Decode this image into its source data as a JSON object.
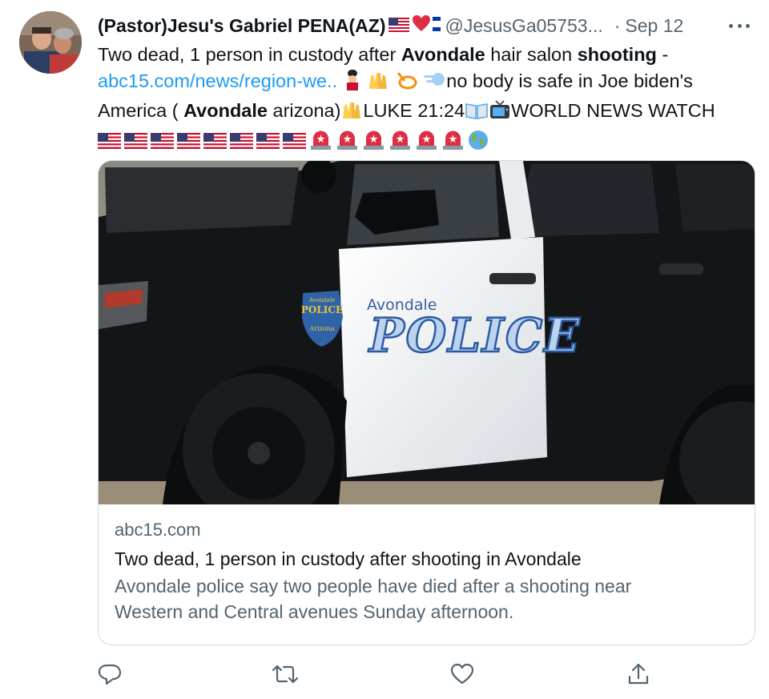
{
  "tweet": {
    "display_name": "(Pastor)Jesu's Gabriel PENA(AZ)",
    "handle": "@JesusGa05753...",
    "separator": "·",
    "date": "Sep 12",
    "text": {
      "part1": "Two dead, 1 person in custody after ",
      "bold1": "Avondale",
      "part2": " hair salon ",
      "bold2": "shooting",
      "part3": " -",
      "link": "abc15.com/news/region-we..",
      "part4": "no body is safe in Joe biden's",
      "part5": "America ( ",
      "bold3": "Avondale",
      "part6": " arizona)",
      "part7": "LUKE 21:24",
      "part8": "WORLD NEWS WATCH"
    },
    "emoji": [
      "guard-emoji",
      "raised-hands-emoji",
      "lasso-emoji",
      "dash-emoji",
      "raised-hands-emoji",
      "open-book-emoji",
      "television-emoji",
      "us-flag-emoji",
      "police-light-emoji",
      "globe-emoji"
    ]
  },
  "card": {
    "image_text": {
      "emblem_top": "Avondale",
      "emblem_main": "POLICE",
      "emblem_bottom": "Arizona",
      "door_city": "Avondale",
      "door_word": "POLICE"
    },
    "domain": "abc15.com",
    "title": "Two dead, 1 person in custody after shooting in Avondale",
    "description_line1": "Avondale police say two people have died after a shooting near",
    "description_line2": "Western and Central avenues Sunday afternoon."
  },
  "actions": [
    "reply-icon",
    "retweet-icon",
    "like-icon",
    "share-icon"
  ],
  "colors": {
    "link": "#1d9bf0",
    "secondary": "#536471",
    "border": "#cfd9de",
    "text": "#0f1419"
  }
}
